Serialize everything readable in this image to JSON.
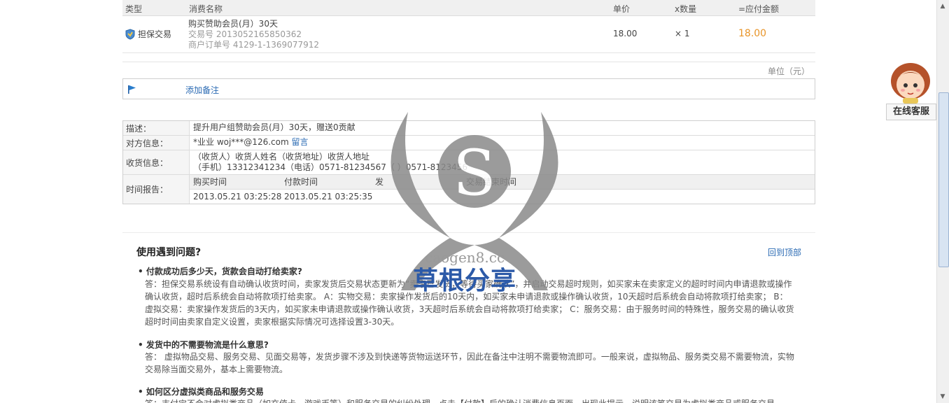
{
  "order_table": {
    "headers": {
      "type": "类型",
      "name": "消费名称",
      "price": "单价",
      "qty": "x数量",
      "total": "=应付金额"
    },
    "row": {
      "type_label": "担保交易",
      "name": "购买赞助会员(月）30天",
      "trade_no": "交易号 2013052165850362",
      "merchant_no": "商户订单号 4129-1-1369077912",
      "price": "18.00",
      "qty": "× 1",
      "total": "18.00"
    }
  },
  "unit_note": "单位（元）",
  "remark": {
    "link": "添加备注"
  },
  "info": {
    "desc_label": "描述：",
    "desc_value": "提升用户组赞助会员(月）30天，赠送0贡献",
    "party_label": "对方信息：",
    "party_value": "*业业 woj***@126.com",
    "party_link": "留言",
    "ship_label": "收货信息：",
    "ship_line1": "（收货人）收货人姓名（收货地址）收货人地址",
    "ship_line2": "（手机）13312341234（电话）0571-81234567（       ）0571-8123456",
    "time_label": "时间报告：",
    "time_headers": [
      "购买时间",
      "付款时间",
      "发",
      "交易结束时间"
    ],
    "time_values": [
      "2013.05.21 03:25:28",
      "2013.05.21 03:25:35",
      "",
      ""
    ]
  },
  "faq": {
    "title": "使用遇到问题?",
    "back_top": "回到顶部",
    "items": [
      {
        "q": "付款成功后多少天，货款会自动打给卖家?",
        "a": "答：担保交易系统设有自动确认收货时间，卖家发货后交易状态更新为“卖家已发货，等待买家确认”，并启动交易超时规则，如买家未在卖家定义的超时时间内申请退款或操作确认收货，超时后系统会自动将款项打给卖家。 A：实物交易：卖家操作发货后的10天内，如买家未申请退款或操作确认收货，10天超时后系统会自动将款项打给卖家； B：虚拟交易：卖家操作发货后的3天内，如买家未申请退款或操作确认收货，3天超时后系统会自动将款项打给卖家； C：服务交易：由于服务时间的特殊性，服务交易的确认收货超时时间由卖家自定义设置，卖家根据实际情况可选择设置3-30天。"
      },
      {
        "q": "发货中的不需要物流是什么意思?",
        "a": "答： 虚拟物品交易、服务交易、见面交易等，发货步骤不涉及到快递等货物运送环节，因此在备注中注明不需要物流即可。一般来说，虚拟物品、服务类交易不需要物流，实物交易除当面交易外，基本上需要物流。"
      },
      {
        "q": "如何区分虚拟类商品和服务交易",
        "a": "答：支付宝不会对虚拟类商品（如充值卡、游戏币等）和服务交易的纠纷处理，点击【付款】后的确认消费信息页面，出现此提示，说明该笔交易为虚拟类商品或服务交易。"
      }
    ]
  },
  "service": {
    "label": "在线客服"
  },
  "watermark": {
    "domain": "caogen8.cc",
    "name": "草根分享",
    "letter": "S"
  }
}
